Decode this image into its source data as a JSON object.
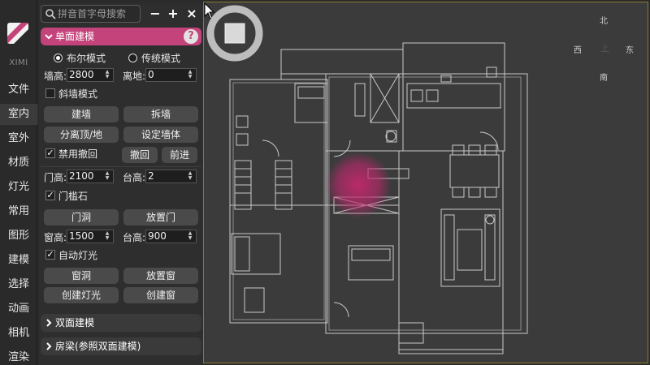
{
  "leftbar": {
    "brand": "XIMI",
    "items": [
      {
        "label": "文件"
      },
      {
        "label": "室内"
      },
      {
        "label": "室外"
      },
      {
        "label": "材质"
      },
      {
        "label": "灯光"
      },
      {
        "label": "常用"
      },
      {
        "label": "图形"
      },
      {
        "label": "建模"
      },
      {
        "label": "选择"
      },
      {
        "label": "动画"
      },
      {
        "label": "相机"
      },
      {
        "label": "渲染"
      }
    ],
    "active": "室内"
  },
  "search": {
    "placeholder": "拼音首字母搜索"
  },
  "toolbar": {
    "minimize": "−",
    "add": "+",
    "close": "×"
  },
  "section_single": {
    "title": "单面建模",
    "help": "?",
    "mode_bool": "布尔模式",
    "mode_traditional": "传统模式",
    "selected_mode": "布尔模式",
    "wall_height_label": "墙高:",
    "wall_height": "2800",
    "floor_offset_label": "离地:",
    "floor_offset": "0",
    "slant_wall_label": "斜墙模式",
    "slant_wall_checked": false,
    "build_wall": "建墙",
    "remove_wall": "拆墙",
    "separate_top": "分离顶/地",
    "set_wall": "设定墙体",
    "disable_undo_label": "禁用撤回",
    "disable_undo_checked": true,
    "undo": "撤回",
    "forward": "前进",
    "door_height_label": "门高:",
    "door_height": "2100",
    "sill_height_label": "台高:",
    "sill_height": "2",
    "threshold_label": "门槛石",
    "threshold_checked": true,
    "door_opening": "门洞",
    "place_door": "放置门",
    "window_height_label": "窗高:",
    "window_height": "1500",
    "window_sill_label": "台高:",
    "window_sill": "900",
    "auto_light_label": "自动灯光",
    "auto_light_checked": true,
    "window_opening": "窗洞",
    "place_window": "放置窗",
    "create_light": "创建灯光",
    "create_window": "创建窗"
  },
  "section_double": {
    "title": "双面建模"
  },
  "section_beam": {
    "title": "房梁(参照双面建模)"
  },
  "viewcube": {
    "top": "上",
    "north": "北",
    "south": "南",
    "east": "东",
    "west": "西"
  },
  "colors": {
    "accent": "#c5437b",
    "viewport_border": "#8c7a35"
  }
}
